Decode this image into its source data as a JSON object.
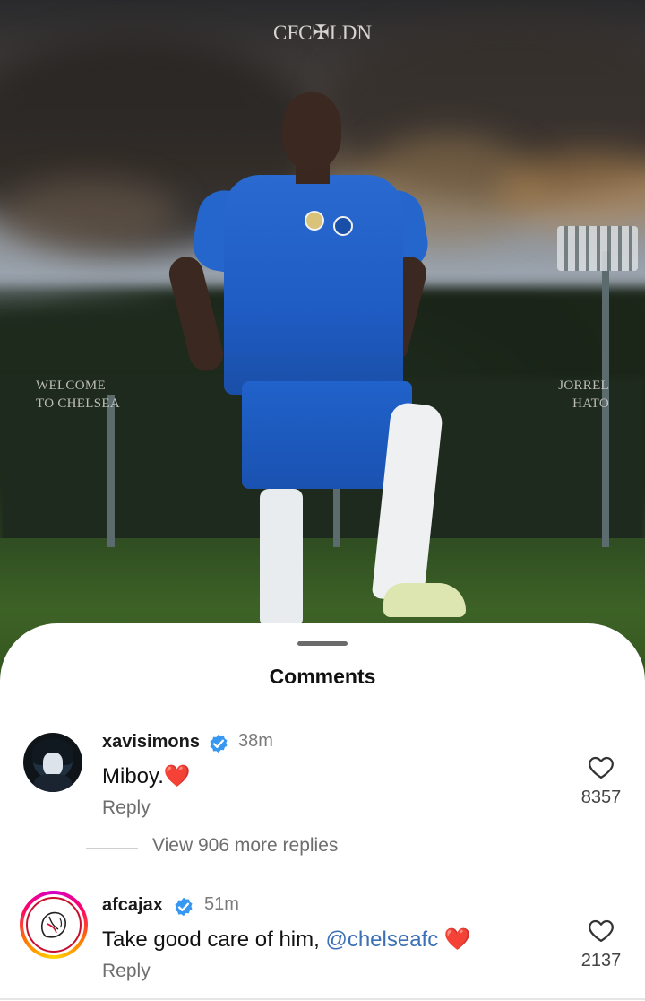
{
  "post": {
    "overlay_logo": "CFC✠LDN",
    "overlay_left": [
      "WELCOME",
      "TO CHELSEA"
    ],
    "overlay_right": [
      "JORREL",
      "HATO"
    ]
  },
  "comments_sheet": {
    "title": "Comments",
    "comments": [
      {
        "username": "xavisimons",
        "verified": true,
        "timestamp": "38m",
        "text": "Miboy.",
        "emoji": "❤️",
        "reply_label": "Reply",
        "like_count": "8357",
        "view_replies_label": "View 906 more replies"
      },
      {
        "username": "afcajax",
        "verified": true,
        "timestamp": "51m",
        "text": "Take good care of him, ",
        "mention": "@chelseafc",
        "emoji": "❤️",
        "reply_label": "Reply",
        "like_count": "2137"
      }
    ]
  },
  "colors": {
    "verified_badge": "#3897f0",
    "mention": "#3b6fb6",
    "heart": "#e0282e",
    "secondary_text": "#6e6e6e"
  },
  "icons": [
    "verified-badge-icon",
    "heart-outline-icon",
    "drag-handle"
  ]
}
